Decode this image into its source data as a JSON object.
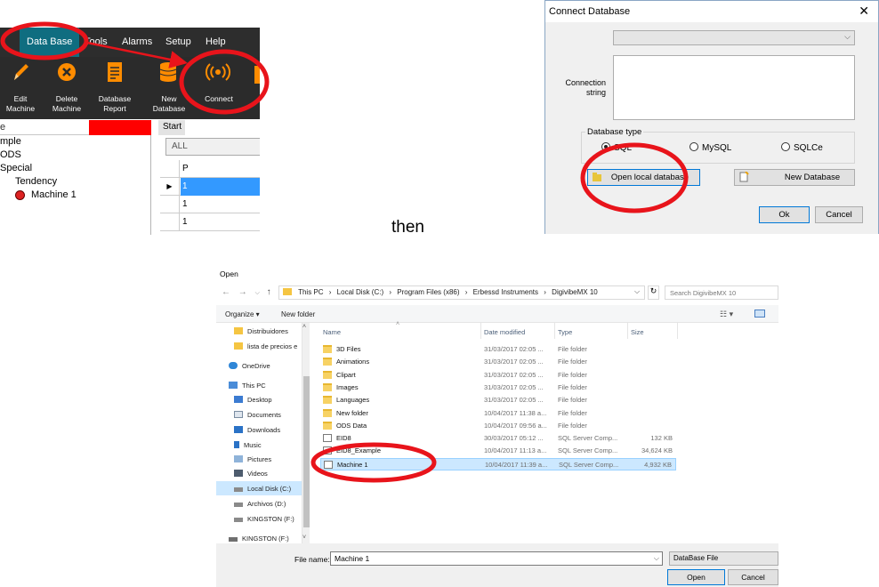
{
  "app": {
    "menu": [
      "Data Base",
      "Tools",
      "Alarms",
      "Setup",
      "Help"
    ],
    "ribbon": [
      {
        "label": "Edit\nMachine",
        "icon": "pencil-icon"
      },
      {
        "label": "Delete\nMachine",
        "icon": "delete-icon"
      },
      {
        "label": "Database\nReport",
        "icon": "report-icon"
      },
      {
        "label": "New\nDatabase",
        "icon": "database-icon"
      },
      {
        "label": "Connect",
        "icon": "connect-icon"
      }
    ],
    "tree_header": "e",
    "tree_items": [
      "mple",
      "ODS",
      "Special",
      "Tendency",
      "Machine 1"
    ],
    "tab": "Start",
    "filter": "ALL",
    "grid_header": "P",
    "grid_rows": [
      "1",
      "1",
      "1"
    ],
    "colors": {
      "menubar": "#2d2d2d",
      "active_menu": "#0f6d80",
      "highlight": "#3399ff",
      "alert": "#ff0000",
      "accent": "#ff8c00"
    }
  },
  "connect_dialog": {
    "title": "Connect Database",
    "close": "✕",
    "combo_value": "",
    "connection_string_label": "Connection string",
    "connection_string_value": "",
    "database_type_label": "Database type",
    "types": [
      {
        "label": "SQL",
        "selected": true
      },
      {
        "label": "MySQL",
        "selected": false
      },
      {
        "label": "SQLCe",
        "selected": false
      }
    ],
    "open_local": "Open local database",
    "new_database": "New Database",
    "ok": "Ok",
    "cancel": "Cancel"
  },
  "then_text": "then",
  "open_dialog": {
    "title": "Open",
    "path": [
      "This PC",
      "Local Disk (C:)",
      "Program Files (x86)",
      "Erbessd Instruments",
      "DigivibeMX 10"
    ],
    "search_placeholder": "Search DigivibeMX 10",
    "organize": "Organize ▾",
    "new_folder": "New folder",
    "sidebar": [
      {
        "label": "Distribuidores",
        "icon": "folder-icon"
      },
      {
        "label": "lista de precios e",
        "icon": "folder-icon"
      },
      {
        "label": "OneDrive",
        "icon": "onedrive-icon"
      },
      {
        "label": "This PC",
        "icon": "computer-icon"
      },
      {
        "label": "Desktop",
        "icon": "desktop-icon"
      },
      {
        "label": "Documents",
        "icon": "documents-icon"
      },
      {
        "label": "Downloads",
        "icon": "downloads-icon"
      },
      {
        "label": "Music",
        "icon": "music-icon"
      },
      {
        "label": "Pictures",
        "icon": "pictures-icon"
      },
      {
        "label": "Videos",
        "icon": "videos-icon"
      },
      {
        "label": "Local Disk (C:)",
        "icon": "drive-icon",
        "selected": true
      },
      {
        "label": "Archivos (D:)",
        "icon": "drive-icon"
      },
      {
        "label": "KINGSTON (F:)",
        "icon": "drive-icon"
      },
      {
        "label": "KINGSTON (F:)",
        "icon": "usb-drive-icon"
      }
    ],
    "columns": [
      "Name",
      "Date modified",
      "Type",
      "Size"
    ],
    "files": [
      {
        "name": "3D Files",
        "date": "31/03/2017 02:05 ...",
        "type": "File folder",
        "size": "",
        "kind": "folder"
      },
      {
        "name": "Animations",
        "date": "31/03/2017 02:05 ...",
        "type": "File folder",
        "size": "",
        "kind": "folder"
      },
      {
        "name": "Clipart",
        "date": "31/03/2017 02:05 ...",
        "type": "File folder",
        "size": "",
        "kind": "folder"
      },
      {
        "name": "Images",
        "date": "31/03/2017 02:05 ...",
        "type": "File folder",
        "size": "",
        "kind": "folder"
      },
      {
        "name": "Languages",
        "date": "31/03/2017 02:05 ...",
        "type": "File folder",
        "size": "",
        "kind": "folder"
      },
      {
        "name": "New folder",
        "date": "10/04/2017 11:38 a...",
        "type": "File folder",
        "size": "",
        "kind": "folder"
      },
      {
        "name": "ODS Data",
        "date": "10/04/2017 09:56 a...",
        "type": "File folder",
        "size": "",
        "kind": "folder"
      },
      {
        "name": "EID8",
        "date": "30/03/2017 05:12 ...",
        "type": "SQL Server Comp...",
        "size": "132 KB",
        "kind": "db"
      },
      {
        "name": "EID8_Example",
        "date": "10/04/2017 11:13 a...",
        "type": "SQL Server Comp...",
        "size": "34,624 KB",
        "kind": "db"
      },
      {
        "name": "Machine 1",
        "date": "10/04/2017 11:39 a...",
        "type": "SQL Server Comp...",
        "size": "4,932 KB",
        "kind": "db",
        "selected": true
      }
    ],
    "file_name_label": "File name:",
    "file_name_value": "Machine 1",
    "file_type": "DataBase File",
    "open": "Open",
    "cancel": "Cancel"
  }
}
